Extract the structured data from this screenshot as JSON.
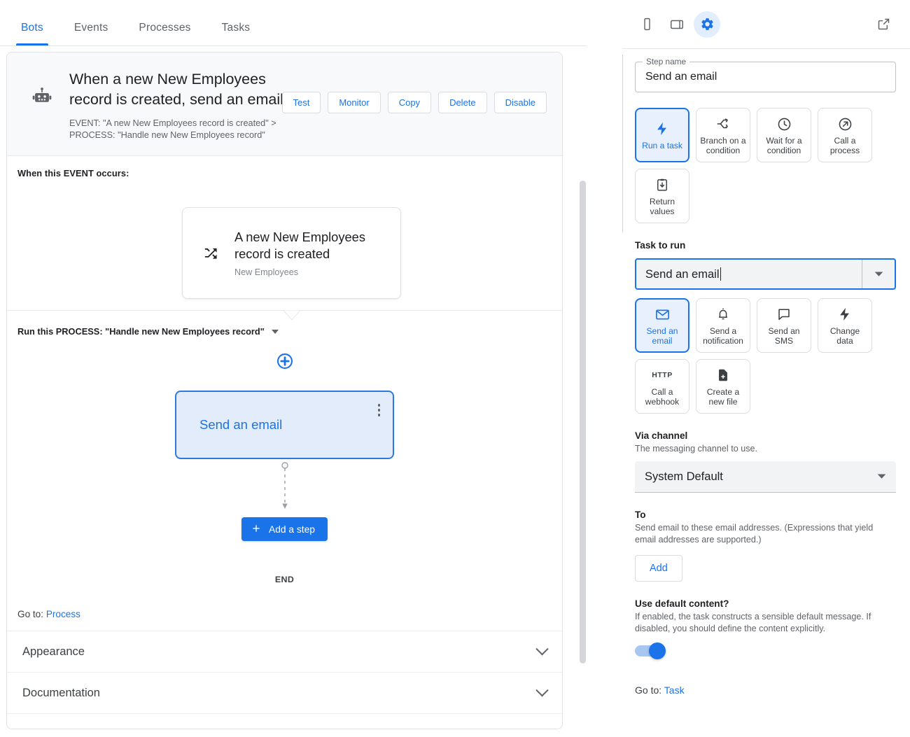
{
  "tabs": [
    {
      "label": "Bots",
      "active": true
    },
    {
      "label": "Events",
      "active": false
    },
    {
      "label": "Processes",
      "active": false
    },
    {
      "label": "Tasks",
      "active": false
    }
  ],
  "bot": {
    "title": "When a new New Employees record is created, send an email",
    "subtitle_line1": "EVENT: \"A new New Employees record is created\" >",
    "subtitle_line2": "PROCESS: \"Handle new New Employees record\"",
    "actions": [
      {
        "label": "Test"
      },
      {
        "label": "Monitor"
      },
      {
        "label": "Copy"
      },
      {
        "label": "Delete"
      },
      {
        "label": "Disable"
      }
    ]
  },
  "flow": {
    "event_section_label": "When this EVENT occurs:",
    "event_card": {
      "title": "A new New Employees record is created",
      "subtitle": "New Employees",
      "icon": "shuffle-icon"
    },
    "process_label": "Run this PROCESS: \"Handle new New Employees record\"",
    "add_icon": "add-circle-icon",
    "step_label": "Send an email",
    "add_step_label": "Add a step",
    "end_label": "END",
    "goto_prefix": "Go to:",
    "goto_link": "Process"
  },
  "accordions": [
    {
      "label": "Appearance"
    },
    {
      "label": "Documentation"
    }
  ],
  "inspector": {
    "toolbar": [
      {
        "name": "phone-icon",
        "active": false
      },
      {
        "name": "tablet-icon",
        "active": false
      },
      {
        "name": "gear-icon",
        "active": true
      }
    ],
    "open_external_icon": "open-in-new-icon",
    "step_name_legend": "Step name",
    "step_name_value": "Send an email",
    "step_types": [
      {
        "label": "Run a task",
        "icon": "bolt-icon",
        "selected": true
      },
      {
        "label": "Branch on a condition",
        "icon": "branch-icon",
        "selected": false
      },
      {
        "label": "Wait for a condition",
        "icon": "clock-icon",
        "selected": false
      },
      {
        "label": "Call a process",
        "icon": "arrow-circle-icon",
        "selected": false
      },
      {
        "label": "Return values",
        "icon": "clipboard-down-icon",
        "selected": false
      }
    ],
    "task_to_run": {
      "label": "Task to run",
      "value": "Send an email"
    },
    "task_types": [
      {
        "label": "Send an email",
        "icon": "mail-icon",
        "selected": true
      },
      {
        "label": "Send a notification",
        "icon": "bell-icon",
        "selected": false
      },
      {
        "label": "Send an SMS",
        "icon": "chat-icon",
        "selected": false
      },
      {
        "label": "Change data",
        "icon": "bolt-icon",
        "selected": false
      },
      {
        "label": "Call a webhook",
        "icon": "http-text-icon",
        "selected": false
      },
      {
        "label": "Create a new file",
        "icon": "file-add-icon",
        "selected": false
      }
    ],
    "via_channel": {
      "title": "Via channel",
      "desc": "The messaging channel to use.",
      "value": "System Default"
    },
    "to": {
      "title": "To",
      "desc": "Send email to these email addresses. (Expressions that yield email addresses are supported.)",
      "add_label": "Add"
    },
    "default_content": {
      "title": "Use default content?",
      "desc": "If enabled, the task constructs a sensible default message. If disabled, you should define the content explicitly.",
      "enabled": true
    },
    "goto_prefix": "Go to:",
    "goto_link": "Task"
  },
  "colors": {
    "accent": "#1a73e8",
    "tile_selected_bg": "#e8f0fe",
    "node_bg": "#e3ecfb",
    "header_bg": "#f8f9fa",
    "text": "#202124",
    "muted": "#5f6368"
  }
}
